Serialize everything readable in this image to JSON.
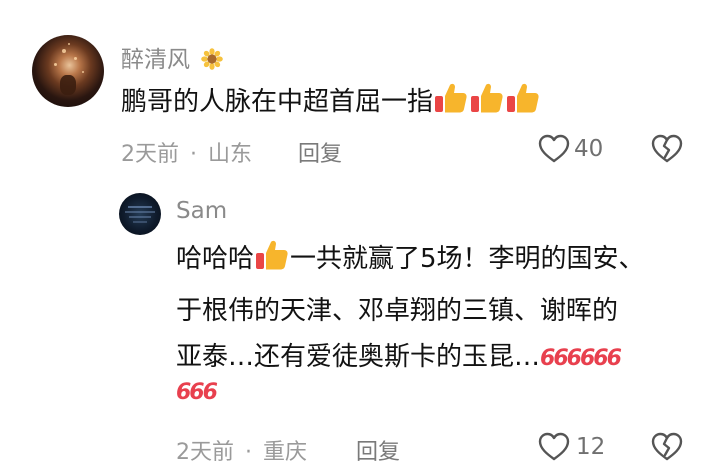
{
  "comment": {
    "username": "醉清风",
    "username_badge_icon": "sunflower-icon",
    "text": "鹏哥的人脉在中超首屈一指",
    "emojis": [
      "thumbs-up-icon",
      "thumbs-up-icon",
      "thumbs-up-icon"
    ],
    "time": "2天前",
    "separator": "·",
    "location": "山东",
    "reply_label": "回复",
    "like_count": "40"
  },
  "reply": {
    "username": "Sam",
    "line1_prefix": "哈哈哈",
    "line1_suffix": "一共就赢了5场！李明的国安、",
    "line2": "于根伟的天津、邓卓翔的三镇、谢晖的",
    "line3": "亚泰…还有爱徒奥斯卡的玉昆…",
    "emoji_666": "666",
    "time": "2天前",
    "separator": "·",
    "location": "重庆",
    "reply_label": "回复",
    "like_count": "12"
  },
  "colors": {
    "text": "#121212",
    "meta": "#9a9a9a",
    "six_red": "#e8404e",
    "thumb_yellow": "#f7b52c"
  }
}
